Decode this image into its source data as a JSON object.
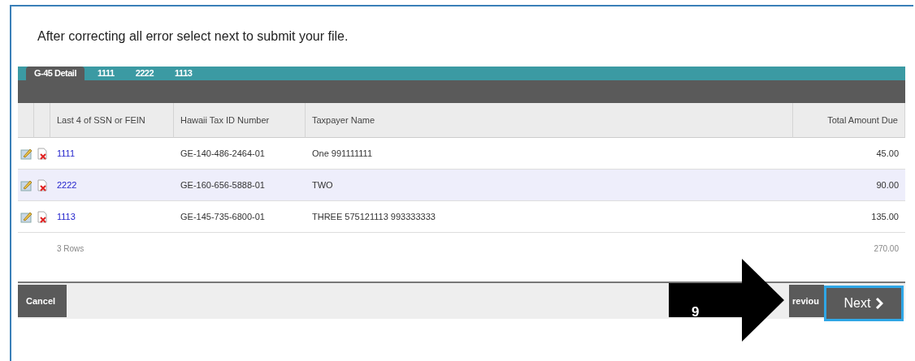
{
  "instruction": "After correcting all error select next to  submit your file.",
  "tabs": [
    {
      "label": "G-45 Detail",
      "selected": true
    },
    {
      "label": "1111",
      "selected": false
    },
    {
      "label": "2222",
      "selected": false
    },
    {
      "label": "1113",
      "selected": false
    }
  ],
  "table": {
    "columns": [
      "Last 4 of SSN or FEIN",
      "Hawaii Tax ID Number",
      "Taxpayer Name",
      "Total Amount Due"
    ],
    "rows": [
      {
        "id": "1111",
        "tax_id": "GE-140-486-2464-01",
        "name": "One 991111111",
        "amount": "45.00",
        "selected": false
      },
      {
        "id": "2222",
        "tax_id": "GE-160-656-5888-01",
        "name": "TWO",
        "amount": "90.00",
        "selected": true
      },
      {
        "id": "1113",
        "tax_id": "GE-145-735-6800-01",
        "name": "THREE 575121113 993333333",
        "amount": "135.00",
        "selected": false
      }
    ],
    "footer": {
      "count": "3 Rows",
      "total": "270.00"
    }
  },
  "buttons": {
    "cancel": "Cancel",
    "previous": "reviou",
    "next": "Next"
  },
  "callout": {
    "number": "9"
  }
}
